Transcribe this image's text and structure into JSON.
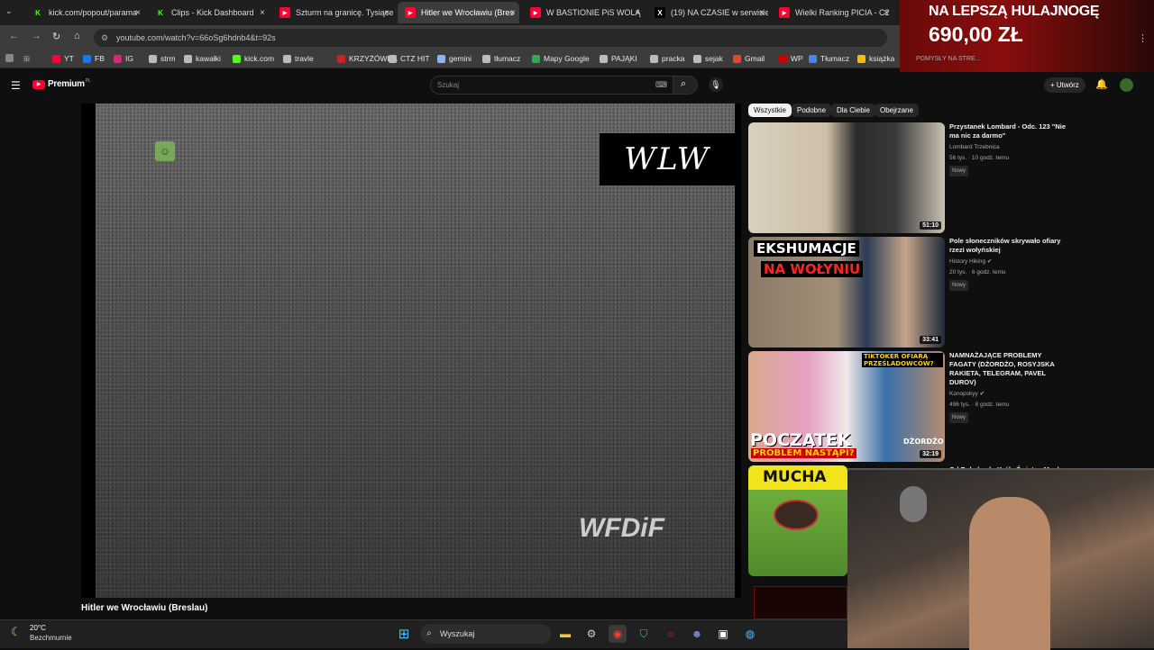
{
  "tabs": [
    {
      "label": "kick.com/popout/parama",
      "favicon_color": "#53fc18",
      "favicon_glyph": "K"
    },
    {
      "label": "Clips - Kick Dashboard",
      "favicon_color": "#53fc18",
      "favicon_glyph": "K"
    },
    {
      "label": "Szturm na granicę. Tysiące",
      "favicon_color": "#ff0033",
      "favicon_glyph": "▶"
    },
    {
      "label": "Hitler we Wrocławiu (Bres",
      "favicon_color": "#ff0033",
      "favicon_glyph": "▶"
    },
    {
      "label": "W BASTIONIE PiS WOLĄ",
      "favicon_color": "#ff0033",
      "favicon_glyph": "▶"
    },
    {
      "label": "(19) NA CZASIE w serwisie",
      "favicon_color": "#000000",
      "favicon_glyph": "X"
    },
    {
      "label": "Wielki Ranking PICIA - C2",
      "favicon_color": "#ff0033",
      "favicon_glyph": "▶"
    }
  ],
  "address_bar": {
    "url": "youtube.com/watch?v=66oSg6hdnb4&t=92s"
  },
  "bookmarks": [
    {
      "label": "YT",
      "color": "#ff0033"
    },
    {
      "label": "FB",
      "color": "#1877f2"
    },
    {
      "label": "IG",
      "color": "#d62976"
    },
    {
      "label": "strm",
      "color": "#bbbbbb"
    },
    {
      "label": "kawałki",
      "color": "#bbbbbb"
    },
    {
      "label": "kick.com",
      "color": "#53fc18"
    },
    {
      "label": "travle",
      "color": "#bbbbbb"
    },
    {
      "label": "KRZYŻÓWKA",
      "color": "#cc2222"
    },
    {
      "label": "CTZ HIT",
      "color": "#bbbbbb"
    },
    {
      "label": "gemini",
      "color": "#8ab4f8"
    },
    {
      "label": "tłumacz",
      "color": "#bbbbbb"
    },
    {
      "label": "Mapy Google",
      "color": "#34a853"
    },
    {
      "label": "PAJĄKI",
      "color": "#bbbbbb"
    },
    {
      "label": "pracka",
      "color": "#bbbbbb"
    },
    {
      "label": "sejak",
      "color": "#bbbbbb"
    },
    {
      "label": "Gmail",
      "color": "#ea4335"
    },
    {
      "label": "WP",
      "color": "#cc0000"
    },
    {
      "label": "Tłumacz",
      "color": "#4285f4"
    },
    {
      "label": "książka",
      "color": "#fbbc05"
    }
  ],
  "youtube": {
    "logo_text": "Premium",
    "logo_superscript": "PL",
    "search_placeholder": "Szukaj",
    "create_label": "Utwórz"
  },
  "player": {
    "watermark_top": "WLW",
    "watermark_bottom": "WFDiF",
    "video_title": "Hitler we Wrocławiu (Breslau)"
  },
  "chips": [
    "Wszystkie",
    "Podobne",
    "Dla Ciebie",
    "Obejrzane"
  ],
  "recommendations": [
    {
      "title": "Przystanek Lombard - Odc. 123 \"Nie ma nic za darmo\"",
      "channel": "Lombard Trzebnica",
      "meta": "56 tys. · 10 godz. temu",
      "badge": "Nowy",
      "duration": "51:10",
      "thumb_color": "#c9c2b2"
    },
    {
      "title": "Pole słoneczników skrywało ofiary rzezi wołyńskiej",
      "channel": "History Hiking",
      "meta": "20 tys. · 6 godz. temu",
      "badge": "Nowy",
      "duration": "33:41",
      "thumb_color": "#8a7a68",
      "thumb_text_1": "EKSHUMACJE",
      "thumb_text_2": "NA WOŁYNIU"
    },
    {
      "title": "NAMNAŻAJĄCE PROBLEMY FAGATY (DŻORDŻO, ROSYJSKA RAKIETA, TELEGRAM, PAVEL DUROV)",
      "channel": "Konopskyy",
      "meta": "496 tys. · 8 godz. temu",
      "badge": "Nowy",
      "duration": "32:19",
      "thumb_color": "#3a6fa8",
      "thumb_text_1": "POCZĄTEK",
      "thumb_text_2": "PROBLEM NASTĄPI?",
      "thumb_text_3": "DŻORDŻO",
      "thumb_text_4": "TIKTOKER OFIARĄ PRZEŚLADOWCÓW?"
    },
    {
      "title": "Od Robaka do Króla Świata - Mucha",
      "channel": "",
      "meta": "",
      "badge": "",
      "duration": "",
      "thumb_color": "#5a9a3a",
      "thumb_text_1": "MUCHA"
    }
  ],
  "promo_overlay": {
    "line1": "NA LEPSZĄ HULAJNOGĘ",
    "line2": "690,00 ZŁ",
    "subtext": "POMYSŁY NA STRE..."
  },
  "taskbar": {
    "weather_temp": "20°C",
    "weather_desc": "Bezchmurnie",
    "search_placeholder": "Wyszukaj"
  }
}
